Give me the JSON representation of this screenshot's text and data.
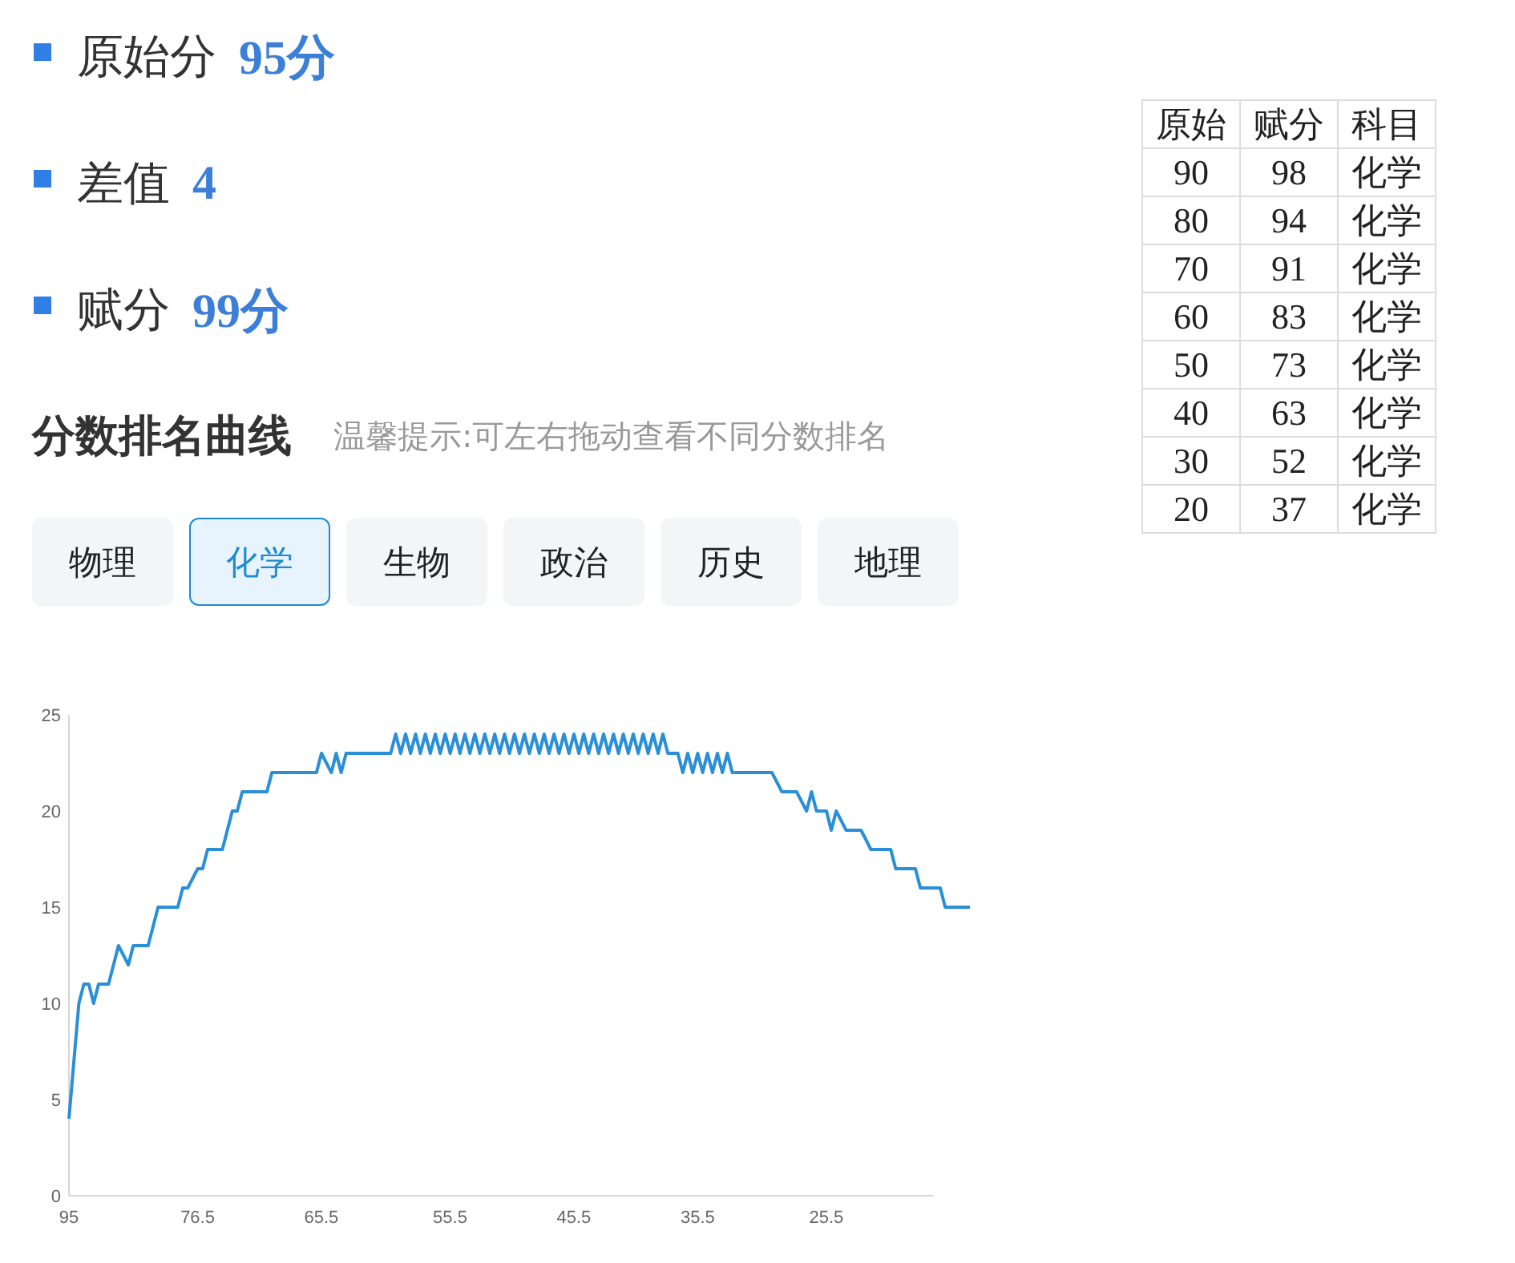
{
  "stats": [
    {
      "label": "原始分",
      "value": "95分"
    },
    {
      "label": "差值",
      "value": "4"
    },
    {
      "label": "赋分",
      "value": "99分"
    }
  ],
  "section": {
    "title": "分数排名曲线",
    "hint": "温馨提示:可左右拖动查看不同分数排名"
  },
  "tabs": [
    {
      "label": "物理",
      "selected": false
    },
    {
      "label": "化学",
      "selected": true
    },
    {
      "label": "生物",
      "selected": false
    },
    {
      "label": "政治",
      "selected": false
    },
    {
      "label": "历史",
      "selected": false
    },
    {
      "label": "地理",
      "selected": false
    }
  ],
  "chart": {
    "chart_data": {
      "type": "line",
      "ylim": [
        0,
        25
      ],
      "yticks": [
        0,
        5,
        10,
        15,
        20,
        25
      ],
      "categories": [
        "95",
        null,
        null,
        null,
        null,
        null,
        null,
        null,
        null,
        null,
        null,
        null,
        null,
        null,
        null,
        null,
        null,
        null,
        null,
        null,
        null,
        null,
        null,
        null,
        null,
        null,
        "76.5",
        null,
        null,
        null,
        null,
        null,
        null,
        null,
        null,
        null,
        null,
        null,
        null,
        null,
        null,
        null,
        null,
        null,
        null,
        null,
        null,
        null,
        null,
        null,
        null,
        "65.5",
        null,
        null,
        null,
        null,
        null,
        null,
        null,
        null,
        null,
        null,
        null,
        null,
        null,
        null,
        null,
        null,
        null,
        null,
        null,
        null,
        null,
        null,
        null,
        null,
        null,
        "55.5",
        null,
        null,
        null,
        null,
        null,
        null,
        null,
        null,
        null,
        null,
        null,
        null,
        null,
        null,
        null,
        null,
        null,
        null,
        null,
        null,
        null,
        null,
        null,
        null,
        "45.5",
        null,
        null,
        null,
        null,
        null,
        null,
        null,
        null,
        null,
        null,
        null,
        null,
        null,
        null,
        null,
        null,
        null,
        null,
        null,
        null,
        null,
        null,
        null,
        null,
        "35.5",
        null,
        null,
        null,
        null,
        null,
        null,
        null,
        null,
        null,
        null,
        null,
        null,
        null,
        null,
        null,
        null,
        null,
        null,
        null,
        null,
        null,
        null,
        null,
        null,
        null,
        "25.5",
        null,
        null,
        null,
        null,
        null,
        null,
        null,
        null,
        null,
        null,
        null,
        null,
        null,
        null,
        null,
        null,
        null,
        null,
        null,
        null,
        null,
        null,
        null,
        null,
        null,
        null,
        null,
        null,
        null
      ],
      "values": [
        4,
        7,
        10,
        11,
        11,
        10,
        11,
        11,
        11,
        12,
        13,
        12.5,
        12,
        13,
        13,
        13,
        13,
        14,
        15,
        15,
        15,
        15,
        15,
        16,
        16,
        16.5,
        17,
        17,
        18,
        18,
        18,
        18,
        19,
        20,
        20,
        21,
        21,
        21,
        21,
        21,
        21,
        22,
        22,
        22,
        22,
        22,
        22,
        22,
        22,
        22,
        22,
        23,
        22.5,
        22,
        23,
        22,
        23,
        23,
        23,
        23,
        23,
        23,
        23,
        23,
        23,
        23,
        24,
        23,
        24,
        23,
        24,
        23,
        24,
        23,
        24,
        23,
        24,
        23,
        24,
        23,
        24,
        23,
        24,
        23,
        24,
        23,
        24,
        23,
        24,
        23,
        24,
        23,
        24,
        23,
        24,
        23,
        24,
        23,
        24,
        23,
        24,
        23,
        24,
        23,
        24,
        23,
        24,
        23,
        24,
        23,
        24,
        23,
        24,
        23,
        24,
        23,
        24,
        23,
        24,
        23,
        24,
        23,
        23,
        23,
        22,
        23,
        22,
        23,
        22,
        23,
        22,
        23,
        22,
        23,
        22,
        22,
        22,
        22,
        22,
        22,
        22,
        22,
        22,
        21.5,
        21,
        21,
        21,
        21,
        20.5,
        20,
        21,
        20,
        20,
        20,
        19,
        20,
        19.5,
        19,
        19,
        19,
        19,
        18.5,
        18,
        18,
        18,
        18,
        18,
        17,
        17,
        17,
        17,
        17,
        16,
        16,
        16,
        16,
        16,
        15,
        15,
        15,
        15,
        15,
        15
      ]
    }
  },
  "table": {
    "columns": [
      "原始",
      "赋分",
      "科目"
    ],
    "rows": [
      [
        "90",
        "98",
        "化学"
      ],
      [
        "80",
        "94",
        "化学"
      ],
      [
        "70",
        "91",
        "化学"
      ],
      [
        "60",
        "83",
        "化学"
      ],
      [
        "50",
        "73",
        "化学"
      ],
      [
        "40",
        "63",
        "化学"
      ],
      [
        "30",
        "52",
        "化学"
      ],
      [
        "20",
        "37",
        "化学"
      ]
    ]
  }
}
